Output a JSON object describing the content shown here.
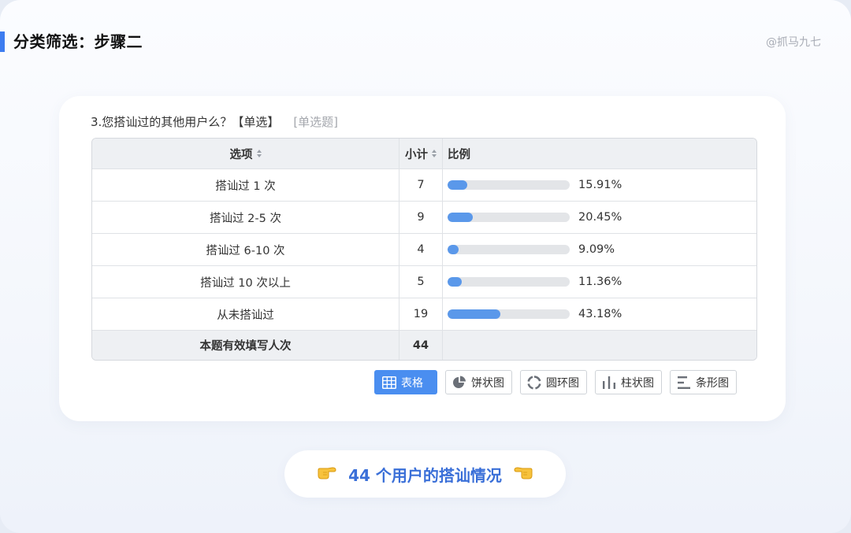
{
  "header": {
    "title": "分类筛选：步骤二",
    "watermark": "@抓马九七"
  },
  "question": {
    "text": "3.您搭讪过的其他用户么？【单选】",
    "type_tag": "[单选题]"
  },
  "table": {
    "columns": {
      "option": "选项",
      "count": "小计",
      "ratio": "比例"
    },
    "rows": [
      {
        "option": "搭讪过 1 次",
        "count": "7",
        "percent": "15.91%",
        "fraction": 0.1591
      },
      {
        "option": "搭讪过 2-5 次",
        "count": "9",
        "percent": "20.45%",
        "fraction": 0.2045
      },
      {
        "option": "搭讪过 6-10 次",
        "count": "4",
        "percent": "9.09%",
        "fraction": 0.0909
      },
      {
        "option": "搭讪过 10 次以上",
        "count": "5",
        "percent": "11.36%",
        "fraction": 0.1136
      },
      {
        "option": "从未搭讪过",
        "count": "19",
        "percent": "43.18%",
        "fraction": 0.4318
      }
    ],
    "total": {
      "label": "本题有效填写人次",
      "count": "44"
    }
  },
  "view_buttons": [
    {
      "label": "表格",
      "icon": "table-icon",
      "active": true
    },
    {
      "label": "饼状图",
      "icon": "pie-chart-icon",
      "active": false
    },
    {
      "label": "圆环图",
      "icon": "donut-chart-icon",
      "active": false
    },
    {
      "label": "柱状图",
      "icon": "bar-chart-icon",
      "active": false
    },
    {
      "label": "条形图",
      "icon": "horizontal-bar-chart-icon",
      "active": false
    }
  ],
  "caption": {
    "text": "44 个用户的搭讪情况",
    "left_icon": "pointing-right-hand-icon",
    "right_icon": "pointing-left-hand-icon"
  },
  "colors": {
    "accent": "#3d7cf0",
    "bar_fill": "#5a98ea",
    "bar_track": "#e3e5e8",
    "active_button": "#4a8ef0",
    "caption_text": "#3a6fd8"
  }
}
